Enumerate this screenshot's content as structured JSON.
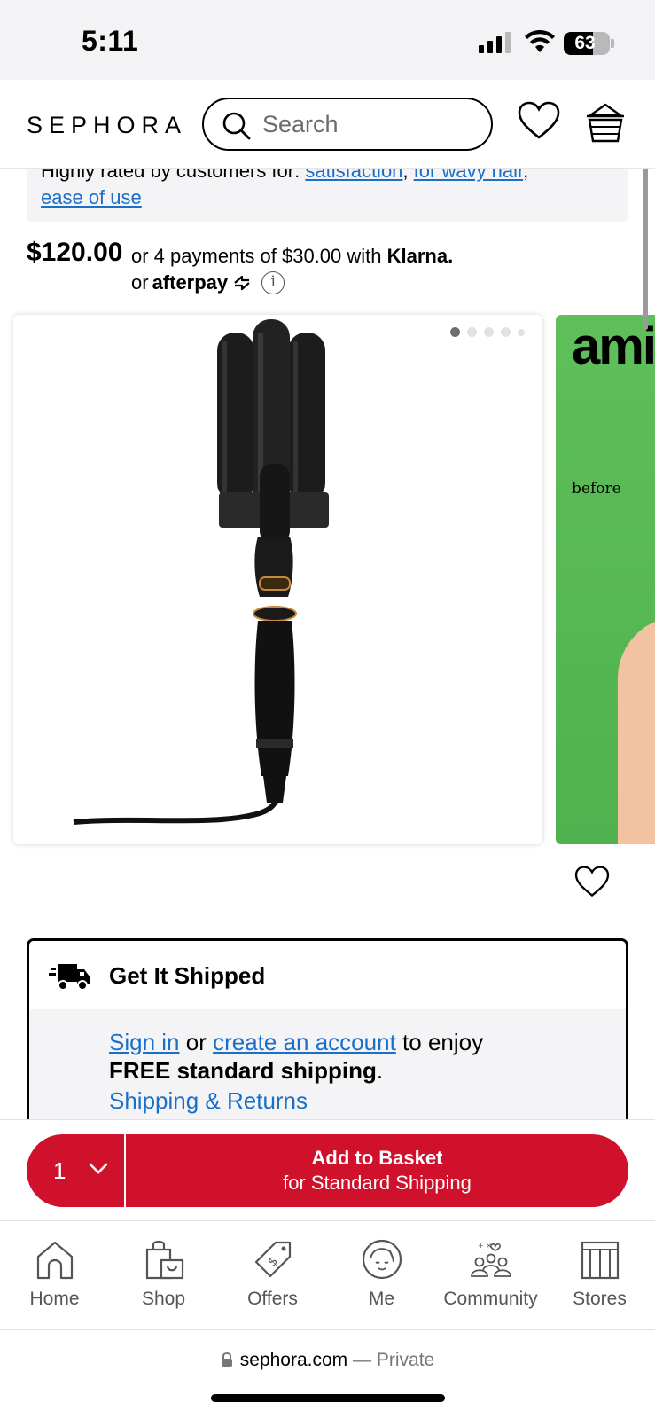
{
  "status_bar": {
    "time": "5:11",
    "battery": "63",
    "battery_fraction": 0.63
  },
  "header": {
    "logo": "SEPHORA",
    "search_placeholder": "Search"
  },
  "rating": {
    "prefix": "Highly rated by customers for:",
    "tags": [
      "satisfaction",
      "for wavy hair",
      "ease of use"
    ]
  },
  "price": {
    "amount": "$120.00",
    "klarna_text": "or 4 payments of $30.00 with",
    "klarna_brand": "Klarna.",
    "afterpay_prefix": "or",
    "afterpay_brand": "afterpay",
    "info_icon": "i"
  },
  "gallery": {
    "image_count": 5,
    "active_index": 0,
    "next_card_brand": "ami",
    "next_card_caption": "before"
  },
  "shipping": {
    "title": "Get It Shipped",
    "sign_in": "Sign in",
    "or": "or",
    "create_account": "create an account",
    "to_enjoy": "to enjoy",
    "free_shipping": "FREE standard shipping",
    "period": ".",
    "returns_link": "Shipping & Returns"
  },
  "basket": {
    "quantity": "1",
    "add_label": "Add to Basket",
    "add_sub": "for Standard Shipping",
    "color": "#cf112c"
  },
  "nav": {
    "items": [
      {
        "label": "Home",
        "icon": "home-icon"
      },
      {
        "label": "Shop",
        "icon": "shopping-bag-icon"
      },
      {
        "label": "Offers",
        "icon": "tag-icon"
      },
      {
        "label": "Me",
        "icon": "face-icon"
      },
      {
        "label": "Community",
        "icon": "community-icon"
      },
      {
        "label": "Stores",
        "icon": "store-icon"
      }
    ]
  },
  "url_bar": {
    "domain": "sephora.com",
    "private": "— Private"
  }
}
